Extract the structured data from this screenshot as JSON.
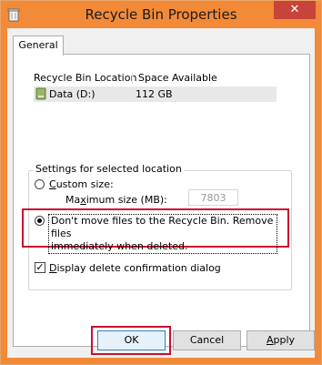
{
  "window": {
    "title": "Recycle Bin Properties",
    "close_label": "✕"
  },
  "tabs": [
    {
      "label": "General"
    }
  ],
  "locations": {
    "header_location": "Recycle Bin Location",
    "header_space": "Space Available",
    "rows": [
      {
        "name": "Data (D:)",
        "space": "112 GB"
      }
    ]
  },
  "settings": {
    "group_label": "Settings for selected location",
    "custom_size": {
      "label_first": "C",
      "label_rest": "ustom size:",
      "selected": false
    },
    "max_size": {
      "label_pre": "Ma",
      "label_ul": "x",
      "label_post": "imum size (MB):",
      "value": "7803"
    },
    "dont_move": {
      "label_line1": "Don't move files to the Recycle Bin. Remove files",
      "label_line2": "immediately when deleted.",
      "selected": true
    },
    "confirm": {
      "label_first": "D",
      "label_rest": "isplay delete confirmation dialog",
      "checked": true
    }
  },
  "buttons": {
    "ok": "OK",
    "cancel": "Cancel",
    "apply_first": "A",
    "apply_rest": "pply"
  },
  "colors": {
    "titlebar": "#f28a37",
    "close_button": "#c7443a",
    "highlight_red": "#c8102e"
  }
}
